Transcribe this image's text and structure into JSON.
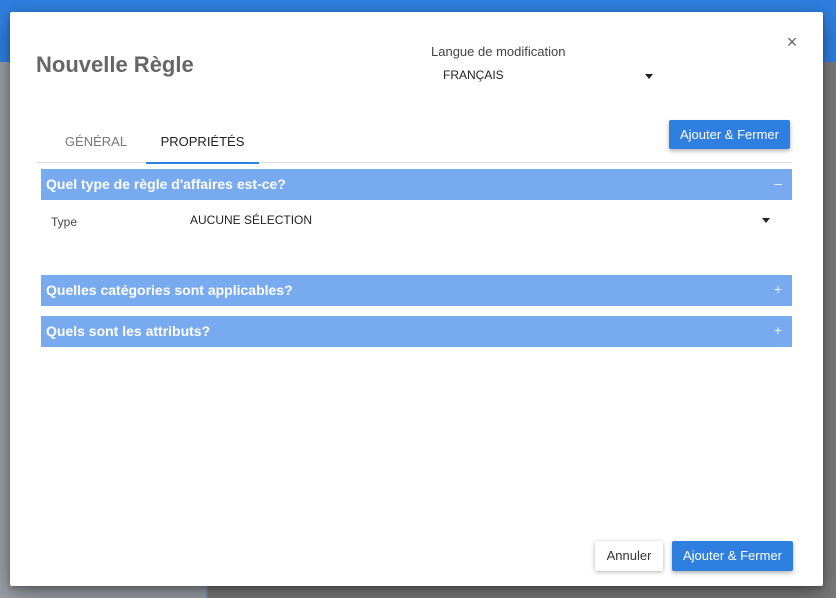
{
  "dialog": {
    "title": "Nouvelle Règle",
    "close_glyph": "×"
  },
  "language": {
    "label": "Langue de modification",
    "selected": "FRANÇAIS"
  },
  "tabs": [
    {
      "label": "GÉNÉRAL",
      "active": false
    },
    {
      "label": "PROPRIÉTÉS",
      "active": true
    }
  ],
  "buttons": {
    "add_close_top": "Ajouter & Fermer",
    "cancel": "Annuler",
    "add_close_bottom": "Ajouter & Fermer"
  },
  "sections": [
    {
      "title": "Quel type de règle d'affaires est-ce?",
      "toggle": "–",
      "expanded": true
    },
    {
      "title": "Quelles catégories sont applicables?",
      "toggle": "+",
      "expanded": false
    },
    {
      "title": "Quels sont les attributs?",
      "toggle": "+",
      "expanded": false
    }
  ],
  "type_field": {
    "label": "Type",
    "selected": "AUCUNE SÉLECTION"
  },
  "colors": {
    "primary": "#2f7fe0",
    "section_header": "#78aaf0",
    "title_text": "#666666"
  },
  "icons": {
    "close": "close-icon",
    "dropdown": "caret-down-icon",
    "collapse": "minus-icon",
    "expand": "plus-icon"
  }
}
